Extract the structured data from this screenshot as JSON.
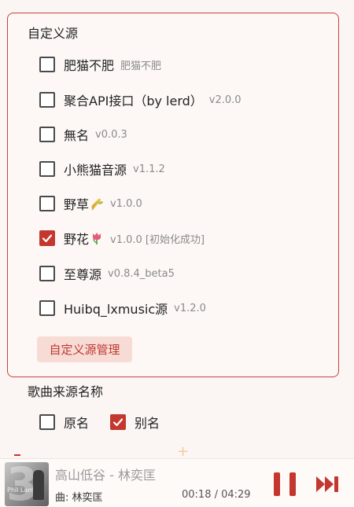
{
  "custom_sources": {
    "title": "自定义源",
    "items": [
      {
        "name": "肥猫不肥",
        "version": "肥猫不肥",
        "checked": false
      },
      {
        "name": "聚合API接口（by lerd）",
        "version": "v2.0.0",
        "checked": false
      },
      {
        "name": "無名",
        "version": "v0.0.3",
        "checked": false
      },
      {
        "name": "小熊猫音源",
        "version": "v1.1.2",
        "checked": false
      },
      {
        "name": "野草",
        "emoji": "wheat-icon",
        "version": "v1.0.0",
        "checked": false
      },
      {
        "name": "野花",
        "emoji": "tulip-icon",
        "version": "v1.0.0 [初始化成功]",
        "checked": true
      },
      {
        "name": "至尊源",
        "version": "v0.8.4_beta5",
        "checked": false
      },
      {
        "name": "Huibq_lxmusic源",
        "version": "v1.2.0",
        "checked": false
      }
    ],
    "manage_button": "自定义源管理"
  },
  "song_source_name": {
    "title": "歌曲来源名称",
    "options": [
      {
        "label": "原名",
        "checked": false
      },
      {
        "label": "别名",
        "checked": true
      }
    ]
  },
  "player": {
    "song_title": "高山低谷 - 林奕匡",
    "sub_info": "曲: 林奕匡",
    "time": "00:18 / 04:29",
    "cover_text": "Phil Lam",
    "cover_mark": "3"
  },
  "colors": {
    "accent": "#c4372f",
    "accent_light": "#f7dcd5",
    "background": "#fbf6f3"
  }
}
